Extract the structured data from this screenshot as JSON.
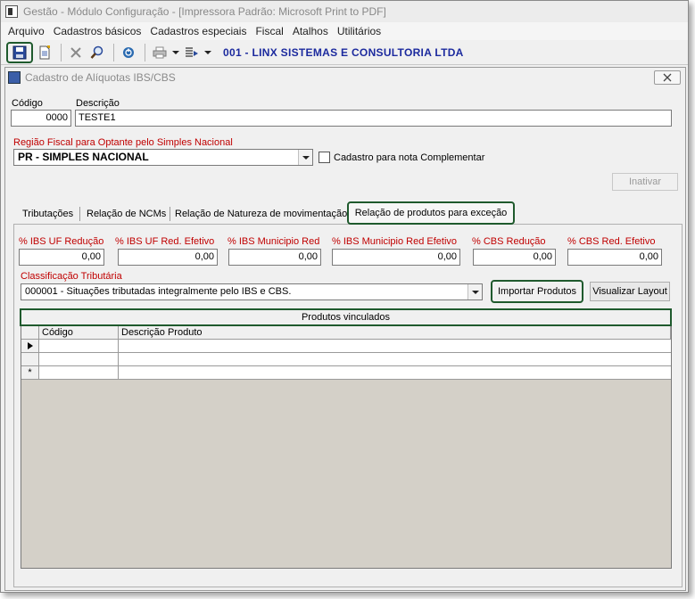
{
  "window": {
    "title": "Gestão  -  Módulo Configuração - [Impressora Padrão: Microsoft Print to PDF]"
  },
  "menu": [
    "Arquivo",
    "Cadastros básicos",
    "Cadastros especiais",
    "Fiscal",
    "Atalhos",
    "Utilitários"
  ],
  "toolbar": {
    "company": "001 - LINX SISTEMAS E CONSULTORIA LTDA"
  },
  "dialog": {
    "title": "Cadastro de Alíquotas IBS/CBS",
    "codigo_label": "Código",
    "codigo_value": "0000",
    "descricao_label": "Descrição",
    "descricao_value": "TESTE1",
    "regiao_label": "Região Fiscal para Optante pelo Simples Nacional",
    "regiao_value": "PR - SIMPLES NACIONAL",
    "complementar_label": "Cadastro para nota Complementar",
    "inativar_label": "Inativar"
  },
  "tabs": [
    {
      "label": "Tributações"
    },
    {
      "label": "Relação de NCMs"
    },
    {
      "label": "Relação de Natureza de movimentação"
    },
    {
      "label": "Relação de produtos para exceção"
    }
  ],
  "rates": {
    "ibs_uf_reducao": {
      "label": "% IBS UF Redução",
      "value": "0,00"
    },
    "ibs_uf_red_efetivo": {
      "label": "% IBS UF Red. Efetivo",
      "value": "0,00"
    },
    "ibs_mun_red": {
      "label": "% IBS Municipio Red",
      "value": "0,00"
    },
    "ibs_mun_red_efetivo": {
      "label": "% IBS Municipio Red Efetivo",
      "value": "0,00"
    },
    "cbs_reducao": {
      "label": "% CBS Redução",
      "value": "0,00"
    },
    "cbs_red_efetivo": {
      "label": "% CBS Red. Efetivo",
      "value": "0,00"
    }
  },
  "classificacao": {
    "label": "Classificação Tributária",
    "value": "000001 - Situações tributadas integralmente pelo IBS e CBS."
  },
  "buttons": {
    "importar": "Importar Produtos",
    "visualizar": "Visualizar Layout"
  },
  "grid": {
    "caption": "Produtos vinculados",
    "columns": [
      "Código",
      "Descrição Produto"
    ],
    "new_row_marker": "*"
  }
}
